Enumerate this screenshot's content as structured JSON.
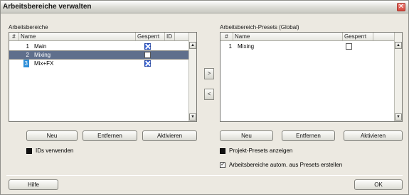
{
  "window": {
    "title": "Arbeitsbereiche verwalten",
    "close_icon": "✕"
  },
  "left": {
    "label": "Arbeitsbereiche",
    "columns": [
      "#",
      "Name",
      "Gesperrt",
      "ID"
    ],
    "rows": [
      {
        "num": "1",
        "name": "Main",
        "locked": true,
        "selected": false
      },
      {
        "num": "2",
        "name": "Mixing",
        "locked": false,
        "selected": true
      },
      {
        "num": "3",
        "name": "Mix+FX",
        "locked": true,
        "selected": false
      }
    ],
    "buttons": {
      "new": "Neu",
      "remove": "Entfernen",
      "activate": "Aktivieren"
    },
    "option_use_ids": "IDs verwenden"
  },
  "right": {
    "label": "Arbeitsbereich-Presets (Global)",
    "columns": [
      "#",
      "Name",
      "Gesperrt"
    ],
    "rows": [
      {
        "num": "1",
        "name": "Mixing",
        "locked": false
      }
    ],
    "buttons": {
      "new": "Neu",
      "remove": "Entfernen",
      "activate": "Aktivieren"
    },
    "option_show_project_presets": "Projekt-Presets anzeigen",
    "option_auto_create": "Arbeitsbereiche autom. aus Presets erstellen"
  },
  "middle": {
    "move_right": ">",
    "move_left": "<"
  },
  "scroll": {
    "up": "▲",
    "down": "▼"
  },
  "footer": {
    "help": "Hilfe",
    "ok": "OK"
  },
  "colors": {
    "selection": "#5f6f8c",
    "checked": "#2c5bd8",
    "accent_number": "#2f8fd8"
  }
}
